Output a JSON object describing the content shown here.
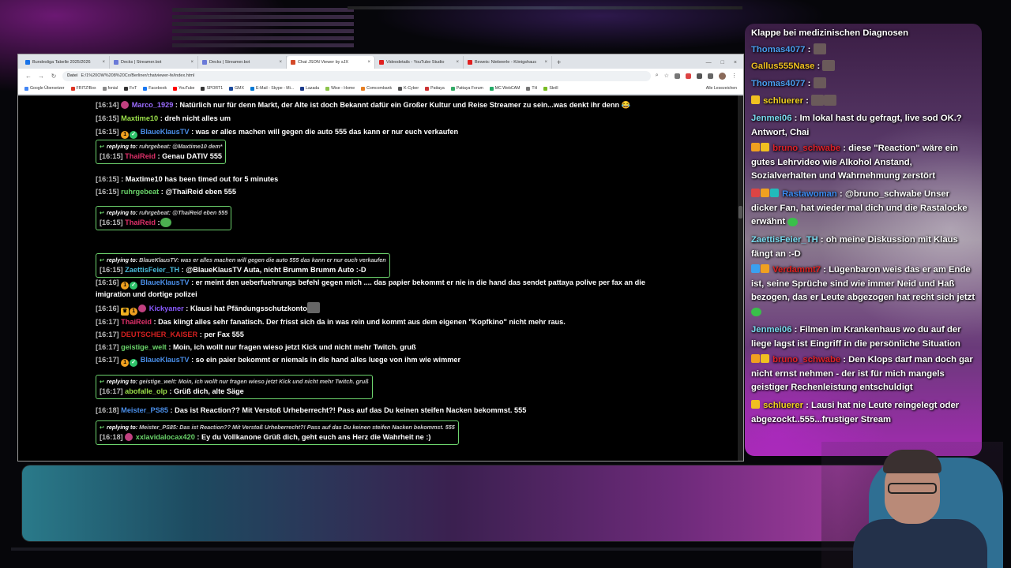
{
  "browser": {
    "tabs": [
      {
        "label": "Bundesliga Tabelle 2025/2026",
        "active": false,
        "color": "#1a73e8"
      },
      {
        "label": "Decks | Streamer.bot",
        "active": false,
        "color": "#6a7ad8"
      },
      {
        "label": "Decks | Streamer.bot",
        "active": false,
        "color": "#6a7ad8"
      },
      {
        "label": "Chat JSON Viewer by sJX",
        "active": true,
        "color": "#d44a2a"
      },
      {
        "label": "Videodetails - YouTube Studio",
        "active": false,
        "color": "#e02020"
      },
      {
        "label": "Beweis: Niebeerle - Königshaus",
        "active": false,
        "color": "#e02020"
      }
    ],
    "new_tab": "+",
    "url_proto": "Datei",
    "url": "E:/1%20OW%208%20Co/Berliner/chatviewer-fe/index.html",
    "bookmarks": [
      "Google Übersetzer",
      "FRITZ!Box",
      "fonial",
      "FoT",
      "Facebook",
      "YouTube",
      "SPORT1",
      "GMX",
      "E-Mail - Skype - Mi...",
      "Lazada",
      "Wise - Home",
      "Comcombank",
      "K-Cyber",
      "Pattaya",
      "Pattaya Forum",
      "MC WebCAM",
      "TH",
      "Skrill"
    ],
    "all_bookmarks": "Alle Lesezeichen"
  },
  "chat": [
    {
      "ts": "[16:14]",
      "badges": [
        "globe"
      ],
      "user": "Marco_1929",
      "color": "#9b6cff",
      "text": ": Natürlich nur für denn Markt, der Alte ist doch Bekannt dafür ein Großer Kultur und Reise Streamer zu sein...was denkt ihr denn 😂"
    },
    {
      "ts": "[16:15]",
      "badges": [],
      "user": "Maxtime10",
      "color": "#9be04a",
      "text": ": dreh nicht alles um"
    },
    {
      "ts": "[16:15]",
      "badges": [
        "gold",
        "green"
      ],
      "user": "BlaueKlausTV",
      "color": "#4a8ee8",
      "text": ": was er alles machen will gegen die auto 555 das kann er nur euch verkaufen"
    },
    {
      "ts": "[16:15]",
      "badges": [],
      "user": "ThaiReid",
      "color": "#e0306a",
      "text": ": Genau DATIV 555",
      "reply_to": "ruhrgebeat",
      "reply_text": ": @Maxtime10 dem*"
    },
    {
      "ts": "[16:15]",
      "badges": [],
      "user": "",
      "color": "#ffffff",
      "text": ": Maxtime10 has been timed out for 5 minutes"
    },
    {
      "ts": "[16:15]",
      "badges": [],
      "user": "ruhrgebeat",
      "color": "#6ad46a",
      "text": ": @ThaiReid eben 555"
    },
    {
      "ts": "[16:15]",
      "badges": [],
      "user": "ThaiReid",
      "color": "#e0306a",
      "text": ":",
      "reply_to": "ruhrgebeat",
      "reply_text": ": @ThaiReid eben 555"
    },
    {
      "ts": "[16:15]",
      "badges": [],
      "user": "ZaettisFeier_TH",
      "color": "#4ab8d8",
      "text": ": @BlaueKlausTV Auta, nicht Brumm Brumm Auto :-D",
      "reply_to": "BlaueKlausTV",
      "reply_text": ": was er alles machen will gegen die auto 555 das kann er nur euch verkaufen"
    },
    {
      "ts": "[16:16]",
      "badges": [
        "gold",
        "green"
      ],
      "user": "BlaueKlausTV",
      "color": "#4a8ee8",
      "text": ": er meint den ueberfuehrungs befehl gegen mich .... das papier bekommt er nie in die hand das sendet pattaya polive per fax an die imigration und dortige polizei"
    },
    {
      "ts": "[16:16]",
      "badges": [
        "crown",
        "gold",
        "globe"
      ],
      "user": "Kickyaner",
      "color": "#8a5aff",
      "text": ": Klausi hat Pfändungsschutzkonto"
    },
    {
      "ts": "[16:17]",
      "badges": [],
      "user": "ThaiReid",
      "color": "#e0306a",
      "text": ": Das klingt alles sehr fanatisch. Der frisst sich da in was rein und kommt aus dem eigenen \"Kopfkino\" nicht mehr raus."
    },
    {
      "ts": "[16:17]",
      "badges": [],
      "user": "DEUTSCHER_KAISER",
      "color": "#d42020",
      "text": ": per Fax 555"
    },
    {
      "ts": "[16:17]",
      "badges": [],
      "user": "geistige_welt",
      "color": "#6ad46a",
      "text": ": Moin, ich wollt nur fragen wieso jetzt Kick und nicht mehr Twitch. gruß"
    },
    {
      "ts": "[16:17]",
      "badges": [
        "gold",
        "green"
      ],
      "user": "BlaueKlausTV",
      "color": "#4a8ee8",
      "text": ": so ein paier bekommt er niemals in die hand alles luege von ihm wie wimmer"
    },
    {
      "ts": "[16:17]",
      "badges": [],
      "user": "abofalle_olp",
      "color": "#9be04a",
      "text": ": Grüß dich, alte Säge",
      "reply_to": "geistige_welt",
      "reply_text": ": Moin, ich wollt nur fragen wieso jetzt Kick und nicht mehr Twitch. gruß"
    },
    {
      "ts": "[16:18]",
      "badges": [],
      "user": "Meister_PS85",
      "color": "#4a8ee8",
      "text": ": Das ist Reaction?? Mit Verstoß Urheberrecht?! Pass auf das Du keinen steifen Nacken bekommst. 555"
    },
    {
      "ts": "[16:18]",
      "badges": [
        "globe"
      ],
      "user": "xxlavidalocax420",
      "color": "#6ad46a",
      "text": ": Ey du Vollkanone Grüß dich, geht euch ans Herz die Wahrheit ne :)",
      "reply_to": "Meister_PS85",
      "reply_text": ": Das ist Reaction?? Mit Verstoß Urheberrecht?! Pass auf das Du keinen steifen Nacken bekommst. 555"
    }
  ],
  "reply_label": "replying to:",
  "side_chat": [
    {
      "user": "",
      "color": "#ffffff",
      "text": "Klappe bei medizinischen Diagnosen"
    },
    {
      "user": "Thomas4077",
      "color": "#4a9ef0",
      "text": ":"
    },
    {
      "user": "Gallus555Nase",
      "color": "#f0c020",
      "text": ":"
    },
    {
      "user": "Thomas4077",
      "color": "#4a9ef0",
      "text": ":"
    },
    {
      "user": "schluerer",
      "color": "#f0d020",
      "text": ":"
    },
    {
      "user": "Jenmei06",
      "color": "#7adcf0",
      "text": ": Im lokal hast du gefragt, live sod OK.? Antwort, Chai"
    },
    {
      "user": "bruno_schwabe",
      "color": "#e0202a",
      "text": ": diese \"Reaction\" wäre ein gutes Lehrvideo wie Alkohol Anstand, Sozialverhalten und Wahrnehmung zerstört"
    },
    {
      "user": "Rastawoman",
      "color": "#3a8af0",
      "text": ": @bruno_schwabe Unser dicker Fan, hat wieder mal dich und die Rastalocke erwähnt"
    },
    {
      "user": "ZaettisFeier_TH",
      "color": "#7adcf0",
      "text": ": oh meine Diskussion mit Klaus fängt an :-D"
    },
    {
      "user": "Verdammt7",
      "color": "#e02020",
      "text": ": Lügenbaron weis das er am Ende ist, seine Sprüche sind wie immer Neid und Haß bezogen, das er Leute abgezogen hat recht sich jetzt"
    },
    {
      "user": "Jenmei06",
      "color": "#7adcf0",
      "text": ": Filmen im Krankenhaus wo du auf der liege lagst ist Eingriff in die persönliche Situation"
    },
    {
      "user": "bruno_schwabe",
      "color": "#e0202a",
      "text": ": Den Klops darf man doch gar nicht ernst nehmen - der ist für mich mangels geistiger Rechenleistung entschuldigt"
    },
    {
      "user": "schluerer",
      "color": "#f0d020",
      "text": ": Lausi hat nie Leute reingelegt oder abgezockt..555...frustiger Stream"
    }
  ]
}
